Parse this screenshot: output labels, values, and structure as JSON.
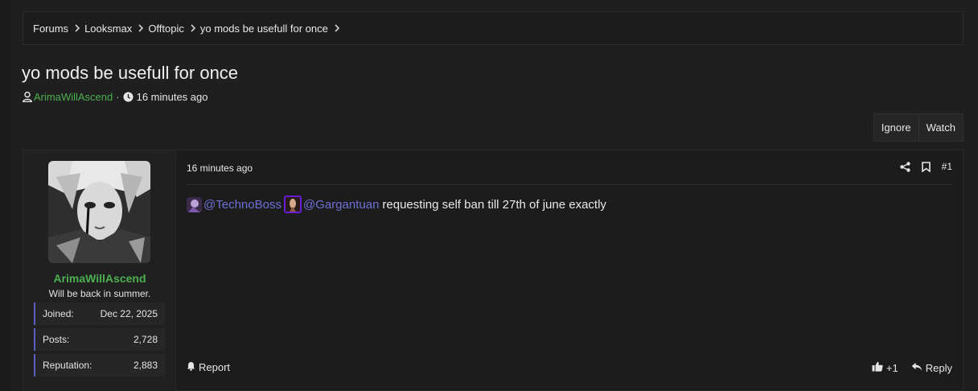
{
  "breadcrumb": [
    {
      "label": "Forums"
    },
    {
      "label": "Looksmax"
    },
    {
      "label": "Offtopic"
    },
    {
      "label": "yo mods be usefull for once"
    }
  ],
  "thread": {
    "title": "yo mods be usefull for once",
    "author": "ArimaWillAscend",
    "separator": "·",
    "time": "16 minutes ago"
  },
  "actions": {
    "ignore": "Ignore",
    "watch": "Watch"
  },
  "post": {
    "user": {
      "name": "ArimaWillAscend",
      "title": "Will be back in summer.",
      "stats": [
        {
          "key": "Joined:",
          "value": "Dec 22, 2025"
        },
        {
          "key": "Posts:",
          "value": "2,728"
        },
        {
          "key": "Reputation:",
          "value": "2,883"
        }
      ]
    },
    "date": "16 minutes ago",
    "number": "#1",
    "mention1": "@TechnoBoss",
    "mention2": "@Gargantuan",
    "text": "requesting self ban till 27th of june exactly",
    "report": "Report",
    "like_count": "+1",
    "reply": "Reply"
  },
  "colors": {
    "accent_green": "#4caf50",
    "mention": "#6f6fd6",
    "stat_border": "#5b5fbf"
  }
}
